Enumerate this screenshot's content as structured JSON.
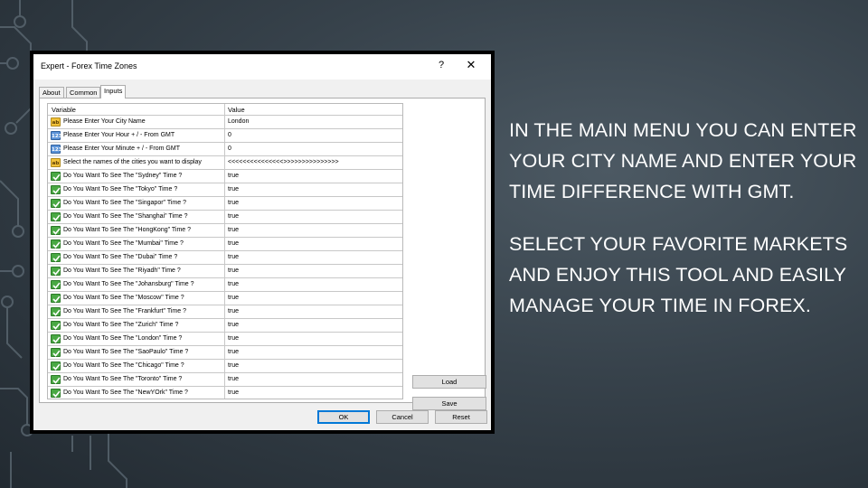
{
  "dialog": {
    "title": "Expert - Forex Time Zones",
    "help_label": "?",
    "close_label": "✕",
    "tabs": [
      {
        "label": "About",
        "active": false
      },
      {
        "label": "Common",
        "active": false
      },
      {
        "label": "Inputs",
        "active": true
      }
    ],
    "columns": {
      "variable": "Variable",
      "value": "Value"
    },
    "rows": [
      {
        "type": "string",
        "icon": "ab",
        "variable": "Please Enter Your City Name",
        "value": "London"
      },
      {
        "type": "int",
        "icon": "123",
        "variable": "Please Enter Your Hour + / - From GMT",
        "value": "0"
      },
      {
        "type": "int",
        "icon": "123",
        "variable": "Please Enter Your Minute + / - From GMT",
        "value": "0"
      },
      {
        "type": "string",
        "icon": "ab",
        "variable": "Select the names of the cities you want to display",
        "value": "<<<<<<<<<<<<<<<>>>>>>>>>>>>>>>"
      },
      {
        "type": "bool",
        "icon": "check",
        "variable": "Do You Want To See The \"Sydney\" Time ?",
        "value": "true"
      },
      {
        "type": "bool",
        "icon": "check",
        "variable": "Do You Want To See The \"Tokyo\" Time ?",
        "value": "true"
      },
      {
        "type": "bool",
        "icon": "check",
        "variable": "Do You Want To See The \"Singapor\" Time ?",
        "value": "true"
      },
      {
        "type": "bool",
        "icon": "check",
        "variable": "Do You Want To See The \"Shanghai\" Time ?",
        "value": "true"
      },
      {
        "type": "bool",
        "icon": "check",
        "variable": "Do You Want To See The \"HongKong\" Time ?",
        "value": "true"
      },
      {
        "type": "bool",
        "icon": "check",
        "variable": "Do You Want To See The \"Mumbai\" Time ?",
        "value": "true"
      },
      {
        "type": "bool",
        "icon": "check",
        "variable": "Do You Want To See The \"Dubai\" Time ?",
        "value": "true"
      },
      {
        "type": "bool",
        "icon": "check",
        "variable": "Do You Want To See The \"Riyadh\" Time ?",
        "value": "true"
      },
      {
        "type": "bool",
        "icon": "check",
        "variable": "Do You Want To See The \"Johansburg\" Time ?",
        "value": "true"
      },
      {
        "type": "bool",
        "icon": "check",
        "variable": "Do You Want To See The \"Moscow\" Time ?",
        "value": "true"
      },
      {
        "type": "bool",
        "icon": "check",
        "variable": "Do You Want To See The \"Frankfurt\" Time ?",
        "value": "true"
      },
      {
        "type": "bool",
        "icon": "check",
        "variable": "Do You Want To See The \"Zurich\" Time ?",
        "value": "true"
      },
      {
        "type": "bool",
        "icon": "check",
        "variable": "Do You Want To See The \"London\" Time ?",
        "value": "true"
      },
      {
        "type": "bool",
        "icon": "check",
        "variable": "Do You Want To See The \"SaoPaulo\" Time ?",
        "value": "true"
      },
      {
        "type": "bool",
        "icon": "check",
        "variable": "Do You Want To See The \"Chicago\" Time ?",
        "value": "true"
      },
      {
        "type": "bool",
        "icon": "check",
        "variable": "Do You Want To See The \"Toronto\" Time ?",
        "value": "true"
      },
      {
        "type": "bool",
        "icon": "check",
        "variable": "Do You Want To See The \"NewYOrk\" Time ?",
        "value": "true"
      }
    ],
    "buttons": {
      "load": "Load",
      "save": "Save",
      "ok": "OK",
      "cancel": "Cancel",
      "reset": "Reset"
    }
  },
  "instructions": {
    "paragraph1": "IN THE MAIN MENU YOU CAN ENTER YOUR CITY NAME AND ENTER YOUR TIME DIFFERENCE WITH GMT.",
    "paragraph2": "SELECT YOUR FAVORITE MARKETS AND ENJOY THIS TOOL AND EASILY MANAGE YOUR TIME IN FOREX."
  },
  "colors": {
    "background": "#37424b",
    "slide_text": "#ffffff",
    "ok_border": "#0078d7",
    "bool_icon": "#49a843",
    "int_icon": "#5b93d8",
    "string_icon": "#f2c23a"
  }
}
